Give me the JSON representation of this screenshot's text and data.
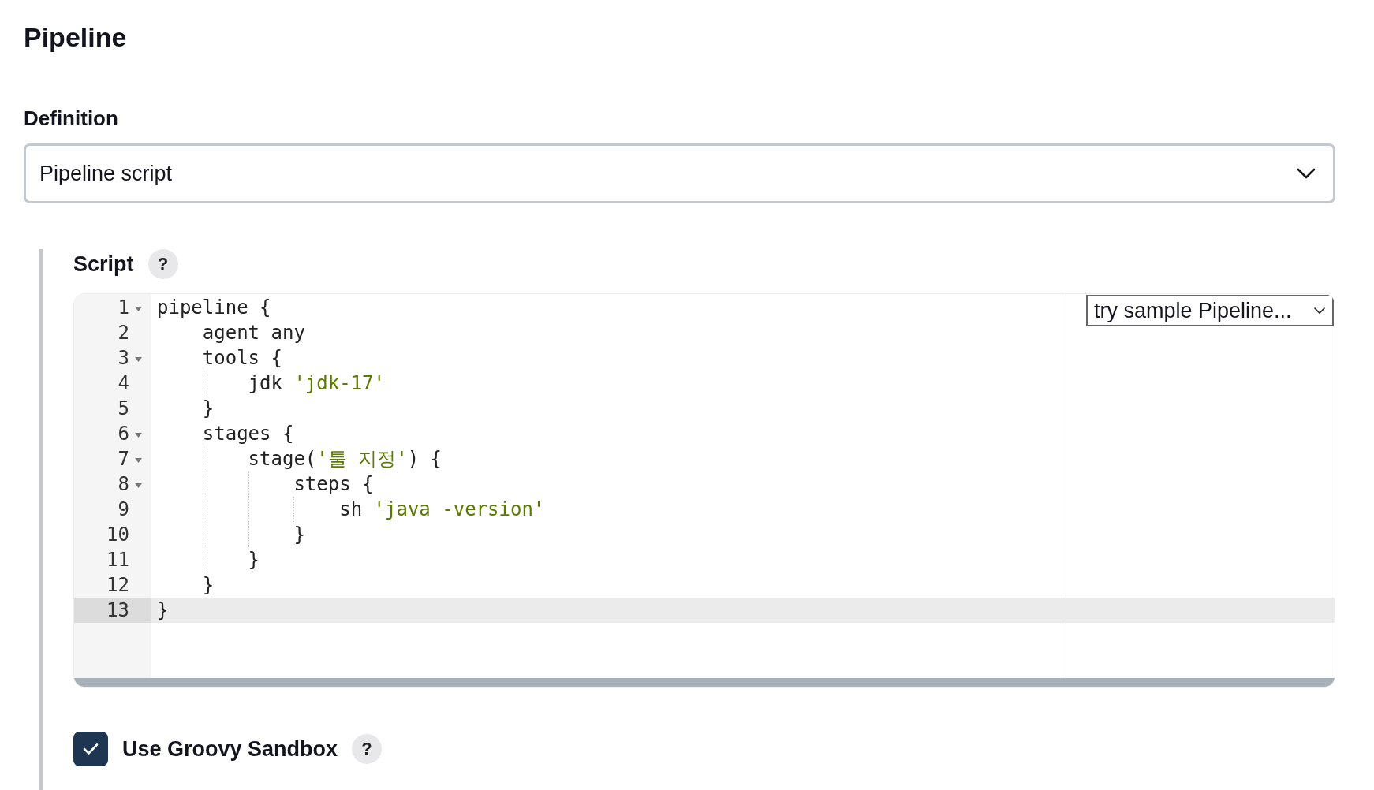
{
  "section_title": "Pipeline",
  "definition": {
    "label": "Definition",
    "value": "Pipeline script"
  },
  "script": {
    "label": "Script",
    "help": "?",
    "sample_select": "try sample Pipeline...",
    "lines": [
      {
        "number": "1",
        "foldable": true,
        "active": false,
        "tokens": [
          {
            "kind": "plain",
            "text": "pipeline {"
          }
        ]
      },
      {
        "number": "2",
        "foldable": false,
        "active": false,
        "tokens": [
          {
            "kind": "plain",
            "text": "    agent any"
          }
        ]
      },
      {
        "number": "3",
        "foldable": true,
        "active": false,
        "tokens": [
          {
            "kind": "plain",
            "text": "    tools {"
          }
        ]
      },
      {
        "number": "4",
        "foldable": false,
        "active": false,
        "tokens": [
          {
            "kind": "plain",
            "text": "        jdk "
          },
          {
            "kind": "string",
            "text": "'jdk-17'"
          }
        ]
      },
      {
        "number": "5",
        "foldable": false,
        "active": false,
        "tokens": [
          {
            "kind": "plain",
            "text": "    }"
          }
        ]
      },
      {
        "number": "6",
        "foldable": true,
        "active": false,
        "tokens": [
          {
            "kind": "plain",
            "text": "    stages {"
          }
        ]
      },
      {
        "number": "7",
        "foldable": true,
        "active": false,
        "tokens": [
          {
            "kind": "plain",
            "text": "        stage("
          },
          {
            "kind": "string",
            "text": "'툴 지정'"
          },
          {
            "kind": "plain",
            "text": ") {"
          }
        ]
      },
      {
        "number": "8",
        "foldable": true,
        "active": false,
        "tokens": [
          {
            "kind": "plain",
            "text": "            steps {"
          }
        ]
      },
      {
        "number": "9",
        "foldable": false,
        "active": false,
        "tokens": [
          {
            "kind": "plain",
            "text": "                sh "
          },
          {
            "kind": "string",
            "text": "'java -version'"
          }
        ]
      },
      {
        "number": "10",
        "foldable": false,
        "active": false,
        "tokens": [
          {
            "kind": "plain",
            "text": "            }"
          }
        ]
      },
      {
        "number": "11",
        "foldable": false,
        "active": false,
        "tokens": [
          {
            "kind": "plain",
            "text": "        }"
          }
        ]
      },
      {
        "number": "12",
        "foldable": false,
        "active": false,
        "tokens": [
          {
            "kind": "plain",
            "text": "    }"
          }
        ]
      },
      {
        "number": "13",
        "foldable": false,
        "active": true,
        "tokens": [
          {
            "kind": "plain",
            "text": "}"
          }
        ]
      }
    ]
  },
  "sandbox": {
    "label": "Use Groovy Sandbox",
    "checked": true,
    "help": "?"
  }
}
